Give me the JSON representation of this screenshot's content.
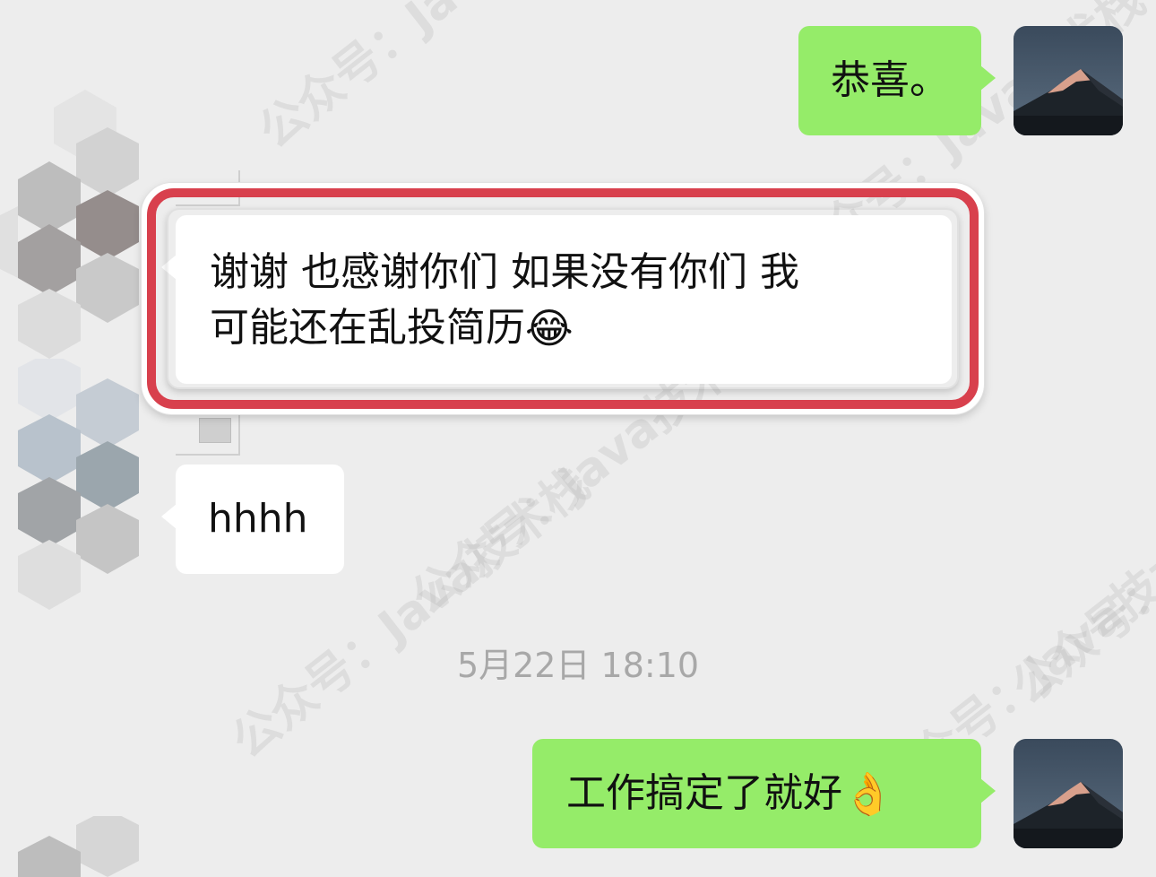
{
  "chat": {
    "messages": [
      {
        "id": "m1",
        "side": "right",
        "text": "恭喜。"
      },
      {
        "id": "m2",
        "side": "left",
        "line1": "谢谢  也感谢你们  如果没有你们 我",
        "line2": "可能还在乱投简历",
        "emoji": "😂"
      },
      {
        "id": "m3",
        "side": "left",
        "text": "hhhh"
      },
      {
        "id": "m4",
        "side": "right",
        "text": "工作搞定了就好",
        "emoji": "👌"
      }
    ],
    "timestamp": "5月22日 18:10"
  },
  "watermark": {
    "text": "公众号：Java技术栈"
  },
  "colors": {
    "background": "#ededed",
    "bubble_self": "#95ec69",
    "bubble_other": "#ffffff",
    "highlight_border": "#d8404d",
    "timestamp": "#a8a8a8"
  }
}
